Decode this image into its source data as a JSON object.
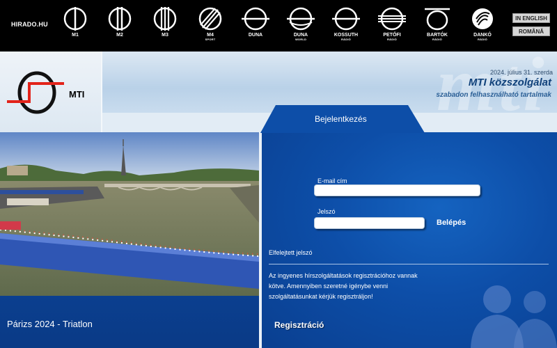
{
  "top_nav": {
    "home_link": "HIRADO.HU",
    "channels": [
      {
        "name": "M1",
        "sub": "",
        "icon": "m1-logo-icon"
      },
      {
        "name": "M2",
        "sub": "",
        "icon": "m2-logo-icon"
      },
      {
        "name": "M3",
        "sub": "",
        "icon": "m3-logo-icon"
      },
      {
        "name": "M4",
        "sub": "SPORT",
        "icon": "m4-sport-logo-icon"
      },
      {
        "name": "DUNA",
        "sub": "",
        "icon": "duna-logo-icon"
      },
      {
        "name": "DUNA",
        "sub": "WORLD",
        "icon": "duna-world-logo-icon"
      },
      {
        "name": "KOSSUTH",
        "sub": "RÁDIÓ",
        "icon": "kossuth-radio-logo-icon"
      },
      {
        "name": "PETŐFI",
        "sub": "RÁDIÓ",
        "icon": "petofi-radio-logo-icon"
      },
      {
        "name": "BARTÓK",
        "sub": "RÁDIÓ",
        "icon": "bartok-radio-logo-icon"
      },
      {
        "name": "DANKÓ",
        "sub": "RÁDIÓ",
        "icon": "danko-radio-logo-icon"
      }
    ],
    "lang_en": "IN ENGLISH",
    "lang_ro": "ROMÂNĂ"
  },
  "header": {
    "logo_text": "MTI",
    "watermark": "mti",
    "title": "MTI közszolgálat",
    "subtitle": "szabadon felhasználható tartalmak",
    "date": "2024. július 31. szerda"
  },
  "feature": {
    "caption": "Párizs 2024 - Triatlon"
  },
  "login": {
    "tab_label": "Bejelentkezés",
    "email_label": "E-mail cím",
    "email_value": "",
    "password_label": "Jelszó",
    "password_value": "",
    "submit_label": "Belépés",
    "forgot_label": "Elfelejtett jelszó",
    "info_text": "Az ingyenes hírszolgáltatások regisztrációhoz vannak kötve. Amennyiben szeretné igénybe venni szolgáltatásunkat kérjük regisztráljon!",
    "register_label": "Regisztráció"
  },
  "colors": {
    "topbar": "#000000",
    "panel_blue": "#0d4ea8",
    "logo_red": "#e2231a",
    "title_blue": "#10417a"
  }
}
